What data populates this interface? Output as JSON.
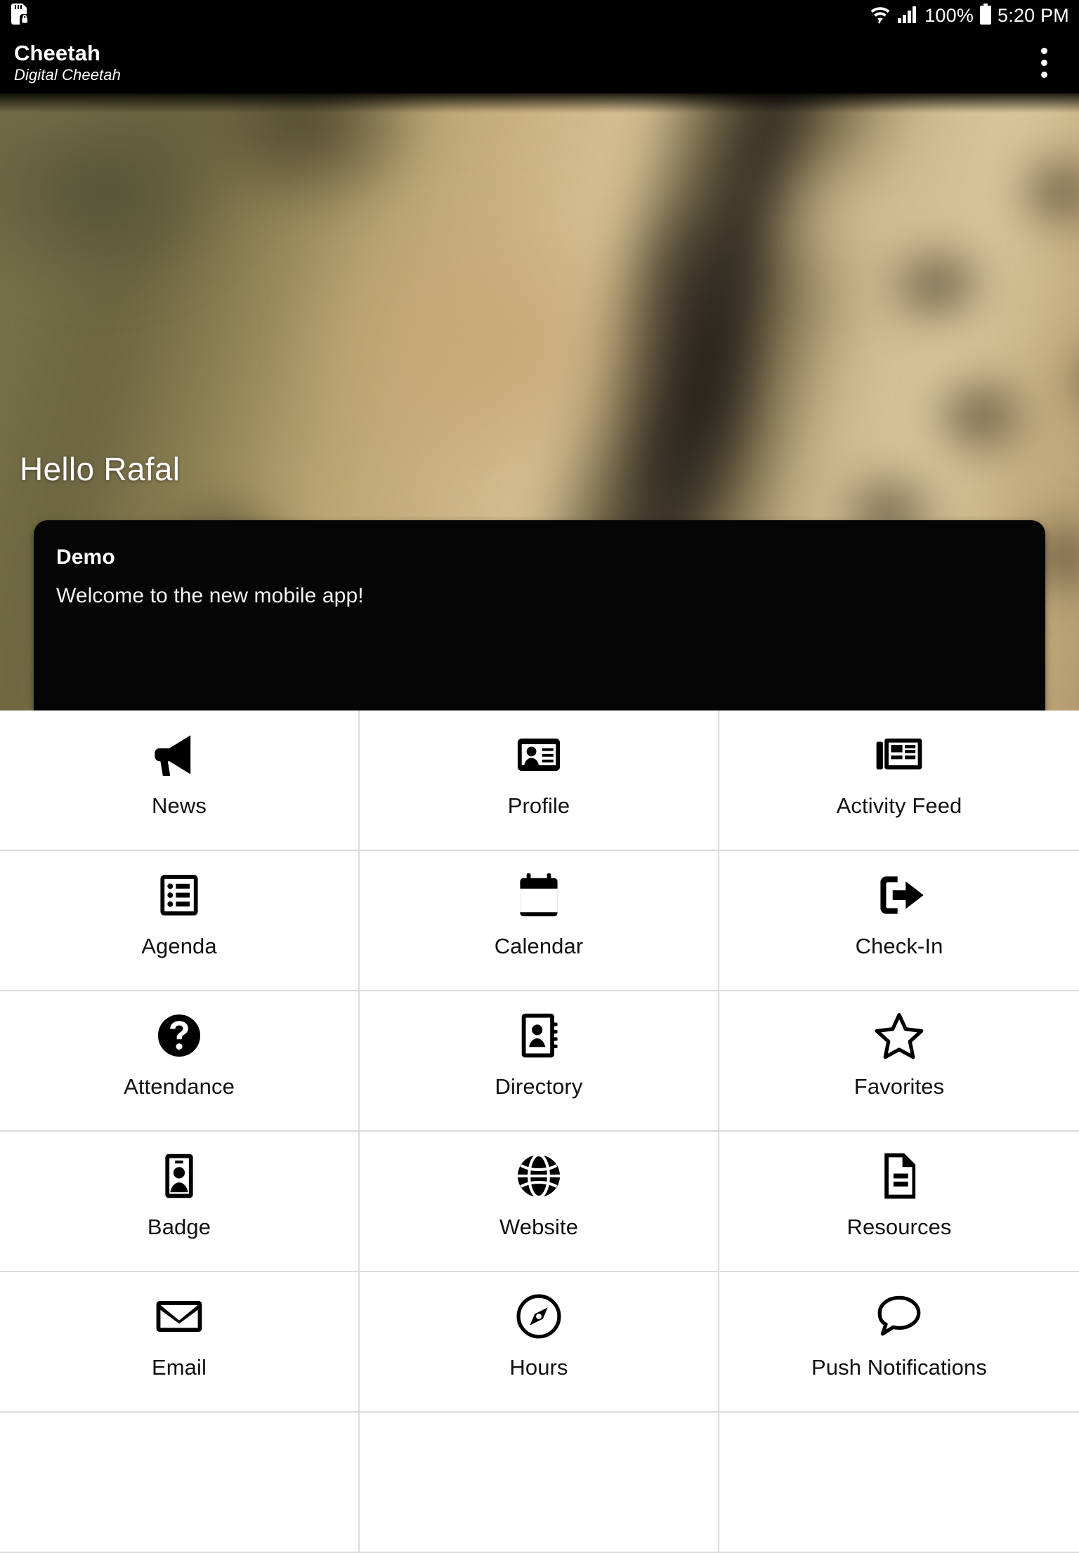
{
  "status_bar": {
    "left_icons": [
      "sd-card-lock-icon"
    ],
    "wifi_icon": "wifi-icon",
    "signal_icon": "cellular-signal-icon",
    "battery_percent": "100%",
    "battery_icon": "battery-full-icon",
    "time": "5:20 PM"
  },
  "app_bar": {
    "title": "Cheetah",
    "subtitle": "Digital Cheetah",
    "overflow_icon": "more-vertical-icon"
  },
  "hero": {
    "greeting": "Hello Rafal",
    "card": {
      "title": "Demo",
      "body": "Welcome to the new mobile app!"
    },
    "carousel": {
      "total_dots": 1,
      "active_index": 0
    }
  },
  "grid": {
    "tiles": [
      {
        "label": "News",
        "icon": "megaphone-icon"
      },
      {
        "label": "Profile",
        "icon": "id-card-icon"
      },
      {
        "label": "Activity Feed",
        "icon": "newspaper-icon"
      },
      {
        "label": "Agenda",
        "icon": "list-icon"
      },
      {
        "label": "Calendar",
        "icon": "calendar-icon"
      },
      {
        "label": "Check-In",
        "icon": "sign-out-icon"
      },
      {
        "label": "Attendance",
        "icon": "question-circle-icon"
      },
      {
        "label": "Directory",
        "icon": "address-book-icon"
      },
      {
        "label": "Favorites",
        "icon": "star-outline-icon"
      },
      {
        "label": "Badge",
        "icon": "badge-icon"
      },
      {
        "label": "Website",
        "icon": "globe-icon"
      },
      {
        "label": "Resources",
        "icon": "document-icon"
      },
      {
        "label": "Email",
        "icon": "envelope-icon"
      },
      {
        "label": "Hours",
        "icon": "compass-icon"
      },
      {
        "label": "Push Notifications",
        "icon": "speech-bubble-icon"
      }
    ]
  },
  "colors": {
    "app_bar_background": "#000000",
    "card_background": "#050505",
    "tile_border": "#dcdcdc",
    "icon_color": "#000000",
    "page_background": "#ffffff"
  }
}
